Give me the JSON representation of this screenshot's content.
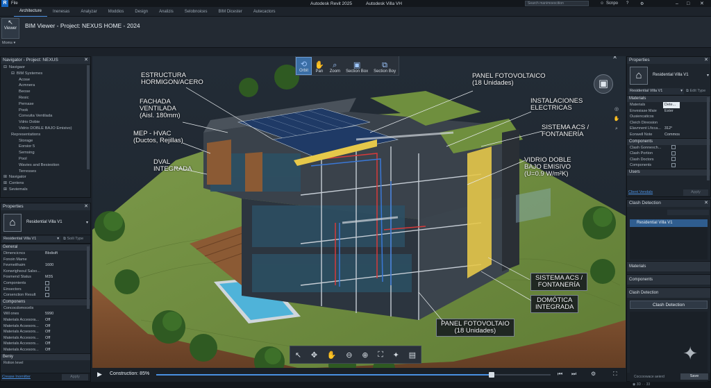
{
  "titlebar": {
    "logo": "R",
    "file_menu": "File",
    "app_title": "Autodesk Revit 2025",
    "app_subtitle": "Autodesk Villa VH",
    "search_placeholder": "Search manimoexcition",
    "user": "Scnpo"
  },
  "ribbon": {
    "tabs": [
      "Architecture",
      "Inenesas",
      "Analyzar",
      "Moddios",
      "Design",
      "Analizis",
      "Selobnoices",
      "BIM Dicester",
      "Autecactors"
    ],
    "viewer_button": "Viewer",
    "more_label": "Moms",
    "view_title": "BIM Viewer - Project: NEXUS HOME - 2024"
  },
  "navigator": {
    "title": "Navigator - Project: NEXUS",
    "items": [
      {
        "label": "Navigaor",
        "level": 0,
        "expander": "⊟"
      },
      {
        "label": "BIM Systemes",
        "level": 1,
        "expander": "⊟"
      },
      {
        "label": "Acose",
        "level": 2
      },
      {
        "label": "Acmnera",
        "level": 2
      },
      {
        "label": "Beose",
        "level": 2
      },
      {
        "label": "Resic",
        "level": 2
      },
      {
        "label": "Pernase",
        "level": 2
      },
      {
        "label": "Pook",
        "level": 2
      },
      {
        "label": "Convuita Ventilada",
        "level": 2
      },
      {
        "label": "Vdrio Dobie",
        "level": 2
      },
      {
        "label": "Vidrio DOBLE BAJO Emisivo)",
        "level": 2
      },
      {
        "label": "Representations",
        "level": 1
      },
      {
        "label": "Storage",
        "level": 2
      },
      {
        "label": "Eorsior 5",
        "level": 2
      },
      {
        "label": "Semsing",
        "level": 2
      },
      {
        "label": "Pool",
        "level": 2
      },
      {
        "label": "Wavies and Besiestion",
        "level": 2
      },
      {
        "label": "Terresses",
        "level": 2
      },
      {
        "label": "Navigator",
        "level": 0,
        "expander": "⊞"
      },
      {
        "label": "Contens",
        "level": 0,
        "expander": "⊞"
      },
      {
        "label": "Seviemals",
        "level": 0,
        "expander": "⊞"
      }
    ]
  },
  "properties_left": {
    "title": "Properties",
    "family_name": "Residential Villa V1",
    "type_selector": "Residential Villa V1",
    "edit_type": "Soili Type",
    "sections": [
      {
        "name": "General",
        "rows": [
          {
            "k": "Dimencicncs",
            "v": "Bbdisift"
          },
          {
            "k": "Fonoin Mame",
            "v": ""
          },
          {
            "k": "Fevmeithaim",
            "v": "1600"
          },
          {
            "k": "Konwrighsoul Salso...",
            "v": ""
          },
          {
            "k": "Fosmend Status",
            "v": "M3S"
          },
          {
            "k": "Componients",
            "v": "",
            "check": true
          },
          {
            "k": "Einsectors",
            "v": "",
            "check": true
          },
          {
            "k": "Corsenction Result",
            "v": "",
            "check": true
          }
        ]
      },
      {
        "name": "Componens",
        "rows": [
          {
            "k": "Concocdomocelis",
            "v": ""
          },
          {
            "k": "Will ones",
            "v": "5990"
          },
          {
            "k": "Materials Accesora...",
            "v": "Off"
          },
          {
            "k": "Materials Acsesors...",
            "v": "Off"
          },
          {
            "k": "Materials Acsesors...",
            "v": "Off"
          },
          {
            "k": "Materials Accesors...",
            "v": "Off"
          },
          {
            "k": "Materials Accesors...",
            "v": "Off"
          },
          {
            "k": "Materials Accesors...",
            "v": "Off"
          }
        ]
      },
      {
        "name": "Beniy",
        "rows": [
          {
            "k": "Rolion level",
            "v": ""
          }
        ]
      }
    ],
    "help_link": "Crease Inornitter",
    "apply": "Apply"
  },
  "view_toolbar": [
    {
      "icon": "orbit-icon",
      "glyph": "⟲",
      "label": "Orbit"
    },
    {
      "icon": "pan-icon",
      "glyph": "✋",
      "label": "Pan"
    },
    {
      "icon": "zoom-icon",
      "glyph": "⌕",
      "label": "Zoom"
    },
    {
      "icon": "section-box-icon",
      "glyph": "▣",
      "label": "Section Box"
    },
    {
      "icon": "section-boy-icon",
      "glyph": "⧉",
      "label": "Section Boy"
    }
  ],
  "annotations": {
    "estructura": "ESTRUCTURA\nHORMIGON/ACERO",
    "fachada": "FACHADA\nVENTILADA\n(Aisl. 180mm)",
    "mep": "MEP - HVAC\n(Ductos, Rejillas)",
    "dval": "DVAL\nINTEGRADA",
    "panel_top": "PANEL FOTOVOLTAICO\n(18 Unidades)",
    "instalaciones": "INSTALACIONES\nELECTRICAS",
    "acs_top": "SISTEMA ACS /\nFONTANERÍA",
    "vidrio": "VIDRIO DOBLE\nBAJO EMISIVO\n(U=0.9 W/m²K)",
    "acs_bottom": "SISTEMA ACS /\nFONTANERÍA",
    "domotica": "DOMÓTICA\nINTEGRADA",
    "panel_bottom": "PANEL FOTOVOLTAIO\n(18 Unidades)"
  },
  "bottom_toolbar": [
    "select-icon",
    "move-icon",
    "hand-icon",
    "zoom-out-icon",
    "zoom-in-icon",
    "fit-icon",
    "render-icon",
    "layers-icon"
  ],
  "bottom_toolbar_glyphs": [
    "↖",
    "✥",
    "✋",
    "⊖",
    "⊕",
    "⛶",
    "✦",
    "▤"
  ],
  "construction": {
    "label": "Construction: 85%",
    "progress": 0.85
  },
  "properties_right": {
    "title": "Properties",
    "family_name": "Residential Villa V1",
    "type_selector": "Residential Villa V1",
    "edit_type": "Edit Type",
    "materials_header": "Materials",
    "material_rows": [
      {
        "k": "Materials",
        "v": "Dete..."
      },
      {
        "k": "Envesiase Maie",
        "v": "Ester"
      },
      {
        "k": "Ousiencaticos",
        "v": ""
      },
      {
        "k": "Cleich Direosion",
        "v": ""
      },
      {
        "k": "Elavnnent Lficca...",
        "v": "312°"
      },
      {
        "k": "Eonwell Note",
        "v": "Commos"
      }
    ],
    "components_header": "Components",
    "component_rows": [
      {
        "k": "Clash Gonnexch..."
      },
      {
        "k": "Clash Portion"
      },
      {
        "k": "Clash Doctors"
      },
      {
        "k": "Components"
      }
    ],
    "users_header": "Users",
    "users_link": "Client Vendals",
    "apply": "Apply"
  },
  "clash_panel": {
    "title": "Clash Detection",
    "selected": "Residential Villa V1",
    "materials": "Materials",
    "components": "Components",
    "clash_header": "Clash Detection",
    "clash_button": "Clash Detection",
    "footer_text": "Coccoowace aeierd",
    "save": "Save"
  },
  "colors": {
    "accent": "#4a90e2",
    "panel": "#1e252d",
    "viewport": "#202a33"
  }
}
